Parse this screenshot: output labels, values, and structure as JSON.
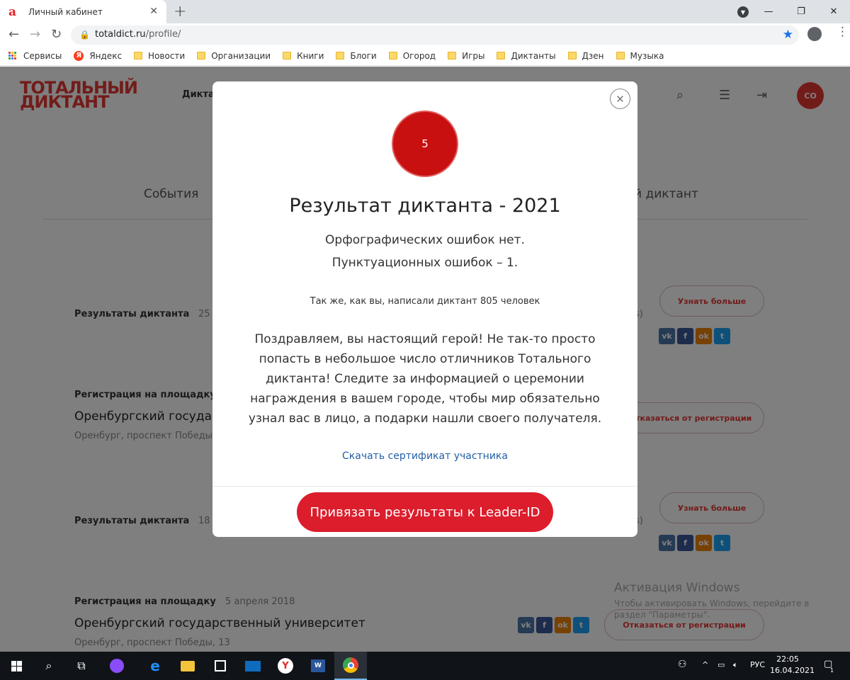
{
  "browser": {
    "tab_title": "Личный кабинет",
    "tab_favicon": "а",
    "url_domain": "totaldict.ru",
    "url_path": "/profile/",
    "bookmarks": [
      "Сервисы",
      "Яндекс",
      "Новости",
      "Организации",
      "Книги",
      "Блоги",
      "Огород",
      "Игры",
      "Диктанты",
      "Дзен",
      "Музыка"
    ]
  },
  "page": {
    "logo_line1": "ТОТАЛЬНЫЙ",
    "logo_line2": "ДИКТАНТ",
    "nav_item": "Дикта",
    "avatar_initials": "СО",
    "tab_events": "События",
    "tab_other": "й диктант",
    "rows": [
      {
        "label": "Результаты диктанта",
        "date": "25"
      },
      {
        "label": "Регистрация на площадку",
        "title": "Оренбургский госуда",
        "sub": "Оренбург, проспект Победы"
      },
      {
        "label": "Результаты диктанта",
        "date": "18"
      },
      {
        "label": "Регистрация на площадку",
        "date": "5 апреля 2018",
        "title": "Оренбургский государственный университет",
        "sub": "Оренбург, проспект Победы, 13"
      }
    ],
    "btn_more": "Узнать больше",
    "btn_unreg": "Отказаться от регистрации",
    "paren": "s)",
    "win_activation_title": "Активация Windows",
    "win_activation_sub": "Чтобы активировать Windows, перейдите в раздел \"Параметры\"."
  },
  "modal": {
    "score": "5",
    "title": "Результат диктанта - 2021",
    "spelling_errors": "Орфографических ошибок нет.",
    "punctuation_errors": "Пунктуационных ошибок – 1.",
    "same_count": "Так же, как вы, написали диктант 805 человек",
    "congrats": "Поздравляем, вы настоящий герой! Не так-то просто попасть в небольшое число отличников Тотального диктанта! Следите за информацией о церемонии награждения в вашем городе, чтобы мир обязательно узнал вас в лицо, а подарки нашли своего получателя.",
    "certificate_link": "Скачать сертификат участника",
    "leader_button": "Привязать результаты к Leader-ID"
  },
  "taskbar": {
    "lang": "РУС",
    "time": "22:05",
    "date": "16.04.2021",
    "notif_count": "1"
  },
  "colors": {
    "accent_red": "#dc1d2c",
    "score_red": "#c81010",
    "link_blue": "#2360a5"
  }
}
